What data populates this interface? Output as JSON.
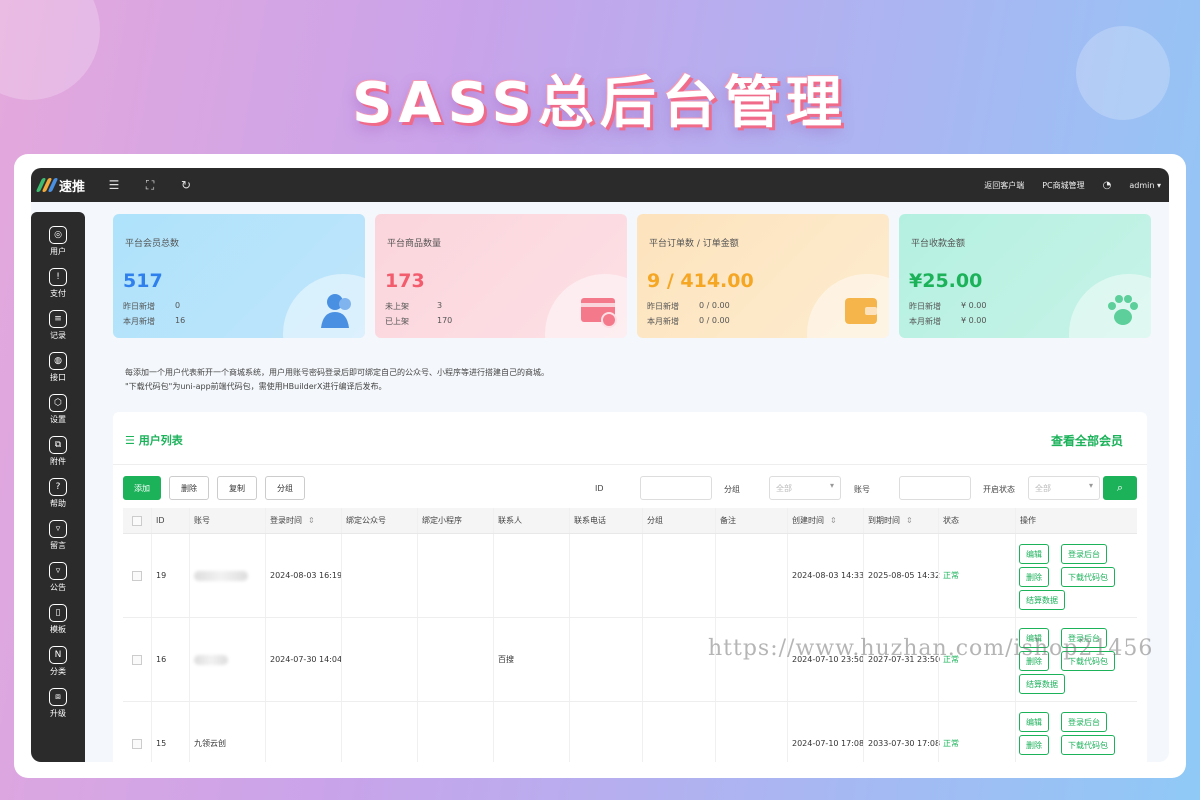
{
  "banner": {
    "title": "SASS总后台管理"
  },
  "topbar": {
    "logo_text": "速推",
    "menu_icon": "menu-icon",
    "fullscreen_icon": "fullscreen-icon",
    "refresh_icon": "refresh-icon",
    "links": [
      "返回客户端",
      "PC商城管理"
    ],
    "theme_icon": "palette-icon",
    "user": "admin"
  },
  "sidebar": {
    "items": [
      {
        "label": "用户",
        "icon": "fingerprint-icon"
      },
      {
        "label": "支付",
        "icon": "shield-icon"
      },
      {
        "label": "记录",
        "icon": "record-icon"
      },
      {
        "label": "接口",
        "icon": "api-icon"
      },
      {
        "label": "设置",
        "icon": "settings-icon"
      },
      {
        "label": "附件",
        "icon": "attachment-icon"
      },
      {
        "label": "帮助",
        "icon": "help-icon"
      },
      {
        "label": "留言",
        "icon": "message-icon"
      },
      {
        "label": "公告",
        "icon": "notice-icon"
      },
      {
        "label": "模板",
        "icon": "template-icon"
      },
      {
        "label": "分类",
        "icon": "category-icon"
      },
      {
        "label": "升级",
        "icon": "upgrade-icon"
      }
    ]
  },
  "cards": [
    {
      "title": "平台会员总数",
      "value": "517",
      "color": "#2f80ed",
      "stats": [
        {
          "label": "昨日新增",
          "value": "0"
        },
        {
          "label": "本月新增",
          "value": "16"
        }
      ],
      "icon": "users-icon"
    },
    {
      "title": "平台商品数量",
      "value": "173",
      "color": "#f25c6d",
      "stats": [
        {
          "label": "未上架",
          "value": "3"
        },
        {
          "label": "已上架",
          "value": "170"
        }
      ],
      "icon": "card-icon"
    },
    {
      "title": "平台订单数 / 订单金额",
      "value": "9 / 414.00",
      "color": "#f5a623",
      "stats": [
        {
          "label": "昨日新增",
          "value": "0 / 0.00"
        },
        {
          "label": "本月新增",
          "value": "0 / 0.00"
        }
      ],
      "icon": "wallet-icon"
    },
    {
      "title": "平台收款金额",
      "value": "¥25.00",
      "color": "#1bb25a",
      "stats": [
        {
          "label": "昨日新增",
          "value": "¥ 0.00"
        },
        {
          "label": "本月新增",
          "value": "¥ 0.00"
        }
      ],
      "icon": "paw-icon"
    }
  ],
  "notice": {
    "line1": "每添加一个用户代表新开一个商城系统，用户用账号密码登录后即可绑定自己的公众号、小程序等进行搭建自己的商城。",
    "line2": "\"下载代码包\"为uni-app前端代码包，需使用HBuilderX进行编译后发布。"
  },
  "panel": {
    "title": "用户列表",
    "view_all": "查看全部会员",
    "buttons": {
      "add": "添加",
      "delete": "删除",
      "copy": "复制",
      "group": "分组"
    },
    "filters": {
      "id_label": "ID",
      "group_label": "分组",
      "group_value": "全部",
      "account_label": "账号",
      "status_label": "开启状态",
      "status_value": "全部"
    }
  },
  "table": {
    "headers": [
      "ID",
      "账号",
      "登录时间",
      "绑定公众号",
      "绑定小程序",
      "联系人",
      "联系电话",
      "分组",
      "备注",
      "创建时间",
      "到期时间",
      "状态",
      "操作"
    ],
    "rows": [
      {
        "id": "19",
        "account": "",
        "login": "2024-08-03 16:19",
        "contact": "",
        "created": "2024-08-03 14:33",
        "expire": "2025-08-05 14:32",
        "status": "正常"
      },
      {
        "id": "16",
        "account": "",
        "login": "2024-07-30 14:04",
        "contact": "百搜",
        "created": "2024-07-10 23:50",
        "expire": "2027-07-31 23:50",
        "status": "正常"
      },
      {
        "id": "15",
        "account": "九领云创",
        "login": "",
        "contact": "",
        "created": "2024-07-10 17:08",
        "expire": "2033-07-30 17:08",
        "status": "正常"
      }
    ],
    "actions": {
      "edit": "编辑",
      "login_admin": "登录后台",
      "delete": "删除",
      "download": "下载代码包",
      "settle": "结算数据"
    }
  },
  "watermark": "https://www.huzhan.com/ishop21456"
}
